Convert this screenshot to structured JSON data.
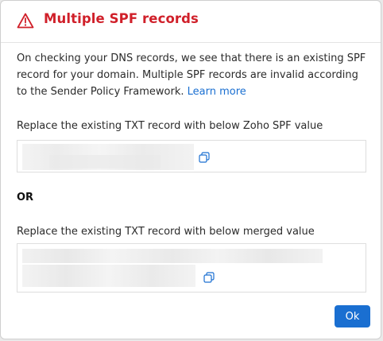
{
  "dialog": {
    "title": "Multiple SPF records",
    "description": "On checking your DNS records, we see that there is an existing SPF record for your domain. Multiple SPF records are invalid according to the Sender Policy Framework. ",
    "learn_more": "Learn more",
    "zoho_spf_label": "Replace the existing TXT record with below Zoho SPF value",
    "or_label": "OR",
    "merged_label": "Replace the existing TXT record with below merged value",
    "ok_label": "Ok"
  },
  "icons": {
    "warning": "warning-triangle-icon",
    "copy": "copy-icon"
  },
  "colors": {
    "title": "#d0202a",
    "accent": "#1a6fd1"
  }
}
